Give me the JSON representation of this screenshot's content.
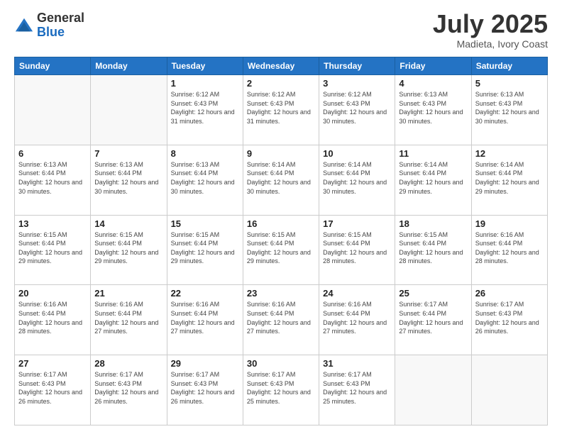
{
  "logo": {
    "general": "General",
    "blue": "Blue"
  },
  "header": {
    "month": "July 2025",
    "location": "Madieta, Ivory Coast"
  },
  "weekdays": [
    "Sunday",
    "Monday",
    "Tuesday",
    "Wednesday",
    "Thursday",
    "Friday",
    "Saturday"
  ],
  "weeks": [
    [
      {
        "day": "",
        "sunrise": "",
        "sunset": "",
        "daylight": ""
      },
      {
        "day": "",
        "sunrise": "",
        "sunset": "",
        "daylight": ""
      },
      {
        "day": "1",
        "sunrise": "Sunrise: 6:12 AM",
        "sunset": "Sunset: 6:43 PM",
        "daylight": "Daylight: 12 hours and 31 minutes."
      },
      {
        "day": "2",
        "sunrise": "Sunrise: 6:12 AM",
        "sunset": "Sunset: 6:43 PM",
        "daylight": "Daylight: 12 hours and 31 minutes."
      },
      {
        "day": "3",
        "sunrise": "Sunrise: 6:12 AM",
        "sunset": "Sunset: 6:43 PM",
        "daylight": "Daylight: 12 hours and 30 minutes."
      },
      {
        "day": "4",
        "sunrise": "Sunrise: 6:13 AM",
        "sunset": "Sunset: 6:43 PM",
        "daylight": "Daylight: 12 hours and 30 minutes."
      },
      {
        "day": "5",
        "sunrise": "Sunrise: 6:13 AM",
        "sunset": "Sunset: 6:43 PM",
        "daylight": "Daylight: 12 hours and 30 minutes."
      }
    ],
    [
      {
        "day": "6",
        "sunrise": "Sunrise: 6:13 AM",
        "sunset": "Sunset: 6:44 PM",
        "daylight": "Daylight: 12 hours and 30 minutes."
      },
      {
        "day": "7",
        "sunrise": "Sunrise: 6:13 AM",
        "sunset": "Sunset: 6:44 PM",
        "daylight": "Daylight: 12 hours and 30 minutes."
      },
      {
        "day": "8",
        "sunrise": "Sunrise: 6:13 AM",
        "sunset": "Sunset: 6:44 PM",
        "daylight": "Daylight: 12 hours and 30 minutes."
      },
      {
        "day": "9",
        "sunrise": "Sunrise: 6:14 AM",
        "sunset": "Sunset: 6:44 PM",
        "daylight": "Daylight: 12 hours and 30 minutes."
      },
      {
        "day": "10",
        "sunrise": "Sunrise: 6:14 AM",
        "sunset": "Sunset: 6:44 PM",
        "daylight": "Daylight: 12 hours and 30 minutes."
      },
      {
        "day": "11",
        "sunrise": "Sunrise: 6:14 AM",
        "sunset": "Sunset: 6:44 PM",
        "daylight": "Daylight: 12 hours and 29 minutes."
      },
      {
        "day": "12",
        "sunrise": "Sunrise: 6:14 AM",
        "sunset": "Sunset: 6:44 PM",
        "daylight": "Daylight: 12 hours and 29 minutes."
      }
    ],
    [
      {
        "day": "13",
        "sunrise": "Sunrise: 6:15 AM",
        "sunset": "Sunset: 6:44 PM",
        "daylight": "Daylight: 12 hours and 29 minutes."
      },
      {
        "day": "14",
        "sunrise": "Sunrise: 6:15 AM",
        "sunset": "Sunset: 6:44 PM",
        "daylight": "Daylight: 12 hours and 29 minutes."
      },
      {
        "day": "15",
        "sunrise": "Sunrise: 6:15 AM",
        "sunset": "Sunset: 6:44 PM",
        "daylight": "Daylight: 12 hours and 29 minutes."
      },
      {
        "day": "16",
        "sunrise": "Sunrise: 6:15 AM",
        "sunset": "Sunset: 6:44 PM",
        "daylight": "Daylight: 12 hours and 29 minutes."
      },
      {
        "day": "17",
        "sunrise": "Sunrise: 6:15 AM",
        "sunset": "Sunset: 6:44 PM",
        "daylight": "Daylight: 12 hours and 28 minutes."
      },
      {
        "day": "18",
        "sunrise": "Sunrise: 6:15 AM",
        "sunset": "Sunset: 6:44 PM",
        "daylight": "Daylight: 12 hours and 28 minutes."
      },
      {
        "day": "19",
        "sunrise": "Sunrise: 6:16 AM",
        "sunset": "Sunset: 6:44 PM",
        "daylight": "Daylight: 12 hours and 28 minutes."
      }
    ],
    [
      {
        "day": "20",
        "sunrise": "Sunrise: 6:16 AM",
        "sunset": "Sunset: 6:44 PM",
        "daylight": "Daylight: 12 hours and 28 minutes."
      },
      {
        "day": "21",
        "sunrise": "Sunrise: 6:16 AM",
        "sunset": "Sunset: 6:44 PM",
        "daylight": "Daylight: 12 hours and 27 minutes."
      },
      {
        "day": "22",
        "sunrise": "Sunrise: 6:16 AM",
        "sunset": "Sunset: 6:44 PM",
        "daylight": "Daylight: 12 hours and 27 minutes."
      },
      {
        "day": "23",
        "sunrise": "Sunrise: 6:16 AM",
        "sunset": "Sunset: 6:44 PM",
        "daylight": "Daylight: 12 hours and 27 minutes."
      },
      {
        "day": "24",
        "sunrise": "Sunrise: 6:16 AM",
        "sunset": "Sunset: 6:44 PM",
        "daylight": "Daylight: 12 hours and 27 minutes."
      },
      {
        "day": "25",
        "sunrise": "Sunrise: 6:17 AM",
        "sunset": "Sunset: 6:44 PM",
        "daylight": "Daylight: 12 hours and 27 minutes."
      },
      {
        "day": "26",
        "sunrise": "Sunrise: 6:17 AM",
        "sunset": "Sunset: 6:43 PM",
        "daylight": "Daylight: 12 hours and 26 minutes."
      }
    ],
    [
      {
        "day": "27",
        "sunrise": "Sunrise: 6:17 AM",
        "sunset": "Sunset: 6:43 PM",
        "daylight": "Daylight: 12 hours and 26 minutes."
      },
      {
        "day": "28",
        "sunrise": "Sunrise: 6:17 AM",
        "sunset": "Sunset: 6:43 PM",
        "daylight": "Daylight: 12 hours and 26 minutes."
      },
      {
        "day": "29",
        "sunrise": "Sunrise: 6:17 AM",
        "sunset": "Sunset: 6:43 PM",
        "daylight": "Daylight: 12 hours and 26 minutes."
      },
      {
        "day": "30",
        "sunrise": "Sunrise: 6:17 AM",
        "sunset": "Sunset: 6:43 PM",
        "daylight": "Daylight: 12 hours and 25 minutes."
      },
      {
        "day": "31",
        "sunrise": "Sunrise: 6:17 AM",
        "sunset": "Sunset: 6:43 PM",
        "daylight": "Daylight: 12 hours and 25 minutes."
      },
      {
        "day": "",
        "sunrise": "",
        "sunset": "",
        "daylight": ""
      },
      {
        "day": "",
        "sunrise": "",
        "sunset": "",
        "daylight": ""
      }
    ]
  ]
}
